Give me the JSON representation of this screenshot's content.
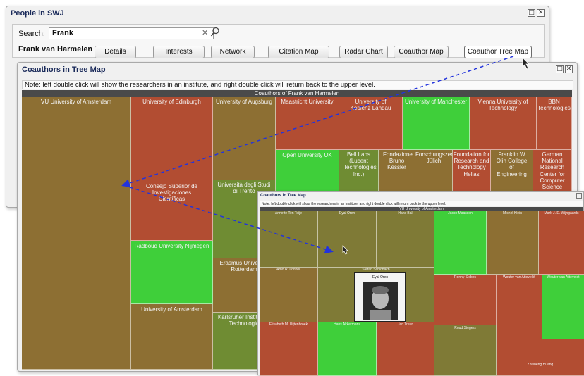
{
  "main_window": {
    "title": "People in SWJ",
    "search_label": "Search:",
    "search_value": "Frank",
    "person_name": "Frank van Harmelen",
    "tabs": [
      "Details",
      "Interests",
      "Network",
      "Citation Map",
      "Radar Chart",
      "Coauthor Map",
      "Coauthor Tree Map"
    ],
    "active_tab": "Coauthor Tree Map"
  },
  "treemap_window": {
    "title": "Coauthors in Tree Map",
    "note": "Note: left double click will show the researchers in an institute, and right double click will return back to the upper level.",
    "header": "Coauthors of Frank van Harmelen",
    "institutions": [
      "VU University of Amsterdam",
      "University of Edinburgh",
      "University of Augsburg",
      "Maastricht University",
      "University of Koblenz Landau",
      "University of Manchester",
      "Vienna University of Technology",
      "BBN Technologies",
      "Open University UK",
      "Bell Labs (Lucent Technologies Inc.)",
      "Fondazione Bruno Kessler",
      "Forschungszentrum Jülich",
      "Foundation for Research and Technology Hellas",
      "Franklin W Olin College of Engineering",
      "German National Research Center for Computer Science",
      "Consejo Superior de Investigaciones Científicas",
      "Università degli Studi di Trento",
      "Radboud University Nijmegen",
      "Erasmus University Rotterdam",
      "University of Amsterdam",
      "Karlsruher Institut für Technologie"
    ]
  },
  "zoom_window": {
    "title": "Coauthors in Tree Map",
    "note": "Note: left double click will show the researchers in an institute, and right double click will return back to the upper level.",
    "header": "VU University of Amsterdam",
    "researchers": [
      "Annette Ten Teije",
      "Eyal Oren",
      "Hans Bal",
      "Jacco Maassen",
      "Michel Klein",
      "Mark J. E. Wijngaards",
      "Arno R. Lodder",
      "Stefan Schlobach",
      "Ronny Siebes",
      "Wouter van Atteveldt",
      "Elisabeth M. Uijtenbroek",
      "Hans Akkermans",
      "Jan Treur",
      "Ruud Stegers",
      "Zhisheng Huang"
    ],
    "tooltip_name": "Eyal Oren"
  },
  "colors": {
    "olive": "#8d6f33",
    "red": "#b24d32",
    "green": "#3fcf3a",
    "mid": "#6f8c33",
    "arrow": "#2233dd"
  },
  "icons": {
    "clear": "close-icon",
    "search": "search-icon",
    "maximize": "maximize-icon",
    "close": "close-icon"
  }
}
